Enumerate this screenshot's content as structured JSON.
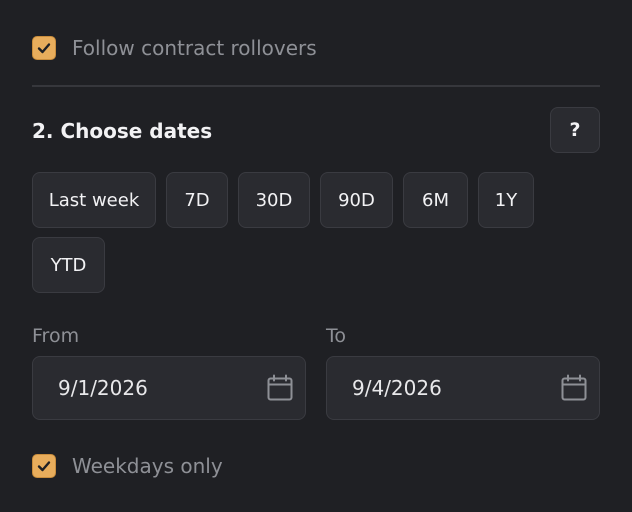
{
  "follow_rollovers": {
    "label": "Follow contract rollovers",
    "checked": true
  },
  "section": {
    "title": "2. Choose dates",
    "help_label": "?"
  },
  "presets": [
    {
      "label": "Last week"
    },
    {
      "label": "7D"
    },
    {
      "label": "30D"
    },
    {
      "label": "90D"
    },
    {
      "label": "6M"
    },
    {
      "label": "1Y"
    },
    {
      "label": "YTD"
    }
  ],
  "from": {
    "label": "From",
    "value": "9/1/2026",
    "icon": "calendar-icon"
  },
  "to": {
    "label": "To",
    "value": "9/4/2026",
    "icon": "calendar-icon"
  },
  "weekdays_only": {
    "label": "Weekdays only",
    "checked": true
  },
  "colors": {
    "background": "#1f2024",
    "accent": "#e8ad5c",
    "surface": "#2a2b30",
    "muted_text": "#8e9096"
  }
}
